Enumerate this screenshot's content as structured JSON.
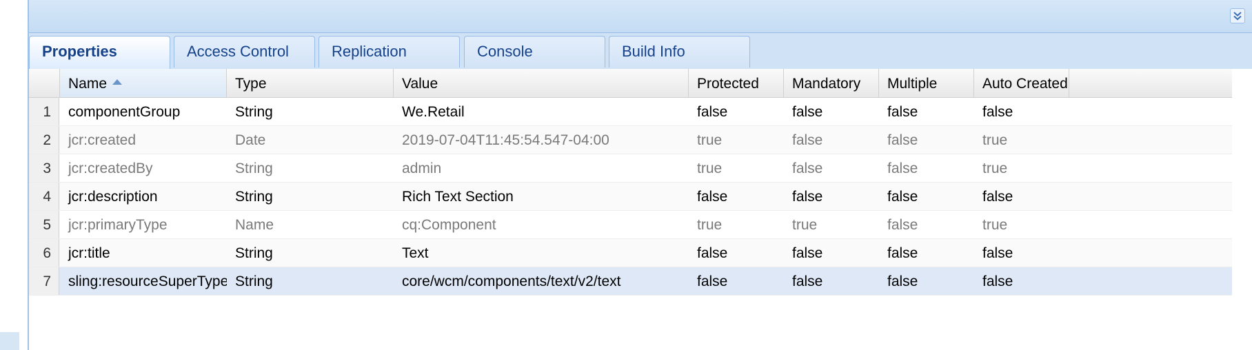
{
  "tabs": [
    {
      "label": "Properties",
      "active": true
    },
    {
      "label": "Access Control",
      "active": false
    },
    {
      "label": "Replication",
      "active": false
    },
    {
      "label": "Console",
      "active": false
    },
    {
      "label": "Build Info",
      "active": false
    }
  ],
  "header": {
    "collapse_icon": "double-chevron-down-icon"
  },
  "grid": {
    "columns": [
      "Name",
      "Type",
      "Value",
      "Protected",
      "Mandatory",
      "Multiple",
      "Auto Created"
    ],
    "sort": {
      "column": "Name",
      "direction": "ascending"
    },
    "rows": [
      {
        "num": "1",
        "name": "componentGroup",
        "type": "String",
        "value": "We.Retail",
        "protected": "false",
        "mandatory": "false",
        "multiple": "false",
        "auto_created": "false"
      },
      {
        "num": "2",
        "name": "jcr:created",
        "type": "Date",
        "value": "2019-07-04T11:45:54.547-04:00",
        "protected": "true",
        "mandatory": "false",
        "multiple": "false",
        "auto_created": "true"
      },
      {
        "num": "3",
        "name": "jcr:createdBy",
        "type": "String",
        "value": "admin",
        "protected": "true",
        "mandatory": "false",
        "multiple": "false",
        "auto_created": "true"
      },
      {
        "num": "4",
        "name": "jcr:description",
        "type": "String",
        "value": "Rich Text Section",
        "protected": "false",
        "mandatory": "false",
        "multiple": "false",
        "auto_created": "false"
      },
      {
        "num": "5",
        "name": "jcr:primaryType",
        "type": "Name",
        "value": "cq:Component",
        "protected": "true",
        "mandatory": "true",
        "multiple": "false",
        "auto_created": "true"
      },
      {
        "num": "6",
        "name": "jcr:title",
        "type": "String",
        "value": "Text",
        "protected": "false",
        "mandatory": "false",
        "multiple": "false",
        "auto_created": "false"
      },
      {
        "num": "7",
        "name": "sling:resourceSuperType",
        "type": "String",
        "value": "core/wcm/components/text/v2/text",
        "protected": "false",
        "mandatory": "false",
        "multiple": "false",
        "auto_created": "false"
      }
    ],
    "selected_row": "7",
    "muted_rows": [
      "2",
      "3",
      "5"
    ]
  },
  "colors": {
    "tab_text": "#15428b",
    "header_bar": "#c4dcf4",
    "selected_row": "#dfe8f6",
    "muted_text": "#7a7a7a"
  }
}
